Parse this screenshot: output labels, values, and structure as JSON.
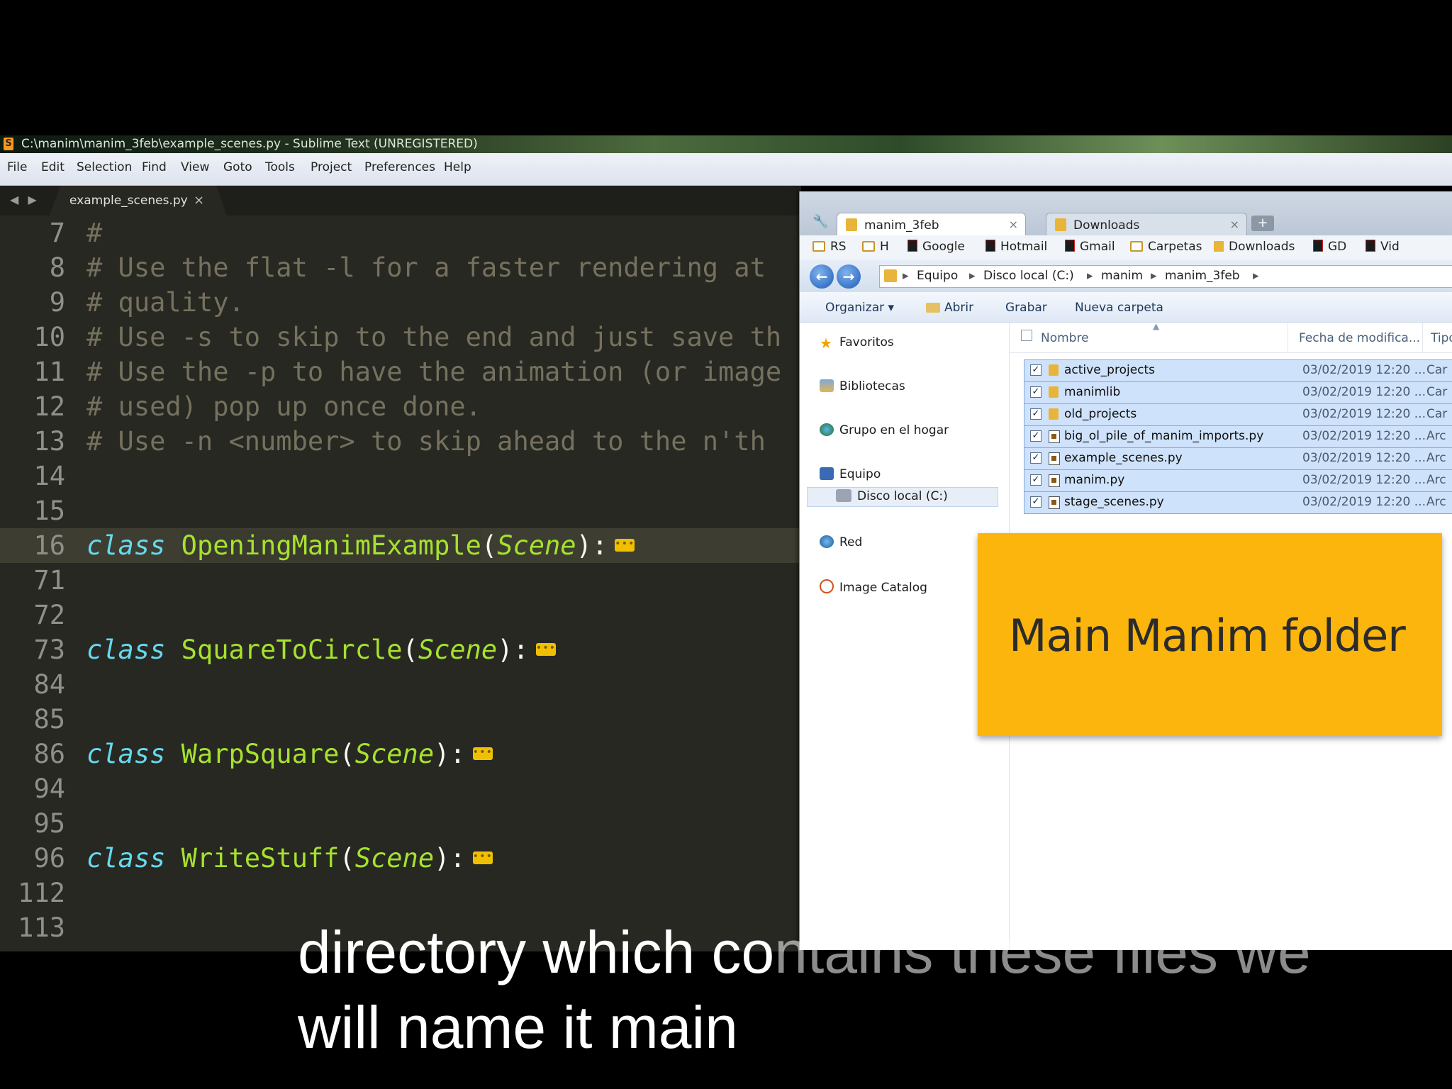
{
  "window": {
    "title": "C:\\manim\\manim_3feb\\example_scenes.py - Sublime Text (UNREGISTERED)",
    "logo": "S"
  },
  "menu": [
    "File",
    "Edit",
    "Selection",
    "Find",
    "View",
    "Goto",
    "Tools",
    "Project",
    "Preferences",
    "Help"
  ],
  "editor": {
    "tab": {
      "label": "example_scenes.py",
      "close": "×"
    },
    "nav_arrows": "◀ ▶",
    "lines": [
      {
        "num": "7",
        "text": "#"
      },
      {
        "num": "8",
        "text": "# Use the flat -l for a faster rendering at"
      },
      {
        "num": "9",
        "text": "# quality."
      },
      {
        "num": "10",
        "text": "# Use -s to skip to the end and just save th"
      },
      {
        "num": "11",
        "text": "# Use the -p to have the animation (or image"
      },
      {
        "num": "12",
        "text": "# used) pop up once done."
      },
      {
        "num": "13",
        "text": "# Use -n <number> to skip ahead to the n'th"
      },
      {
        "num": "14",
        "text": ""
      },
      {
        "num": "15",
        "text": ""
      },
      {
        "num": "16",
        "kw": "class",
        "name": "OpeningManimExample",
        "base": "Scene"
      },
      {
        "num": "71",
        "text": ""
      },
      {
        "num": "72",
        "text": ""
      },
      {
        "num": "73",
        "kw": "class",
        "name": "SquareToCircle",
        "base": "Scene"
      },
      {
        "num": "84",
        "text": ""
      },
      {
        "num": "85",
        "text": ""
      },
      {
        "num": "86",
        "kw": "class",
        "name": "WarpSquare",
        "base": "Scene"
      },
      {
        "num": "94",
        "text": ""
      },
      {
        "num": "95",
        "text": ""
      },
      {
        "num": "96",
        "kw": "class",
        "name": "WriteStuff",
        "base": "Scene"
      },
      {
        "num": "112",
        "text": ""
      },
      {
        "num": "113",
        "text": ""
      }
    ],
    "punct": {
      "open": "(",
      "close": "):",
      "fold": "•••"
    }
  },
  "explorer": {
    "tabs": [
      {
        "label": "manim_3feb",
        "close": "×"
      },
      {
        "label": "Downloads",
        "close": "×"
      }
    ],
    "new_tab": "+",
    "bookmarks": [
      "RS",
      "H",
      "Google",
      "Hotmail",
      "Gmail",
      "Carpetas",
      "Downloads",
      "GD",
      "Vid"
    ],
    "nav": {
      "back": "←",
      "forward": "→"
    },
    "breadcrumbs": [
      "Equipo",
      "Disco local (C:)",
      "manim",
      "manim_3feb"
    ],
    "crumb_sep": "▸",
    "commands": {
      "organize": "Organizar ▾",
      "open": "Abrir",
      "burn": "Grabar",
      "new_folder": "Nueva carpeta"
    },
    "sidebar": [
      "Favoritos",
      "Bibliotecas",
      "Grupo en el hogar",
      "Equipo",
      "Disco local (C:)",
      "Red",
      "Image Catalog"
    ],
    "columns": {
      "name": "Nombre",
      "date": "Fecha de modifica...",
      "type": "Tipo"
    },
    "files": [
      {
        "name": "active_projects",
        "date": "03/02/2019 12:20 ...",
        "type": "Car",
        "kind": "folder"
      },
      {
        "name": "manimlib",
        "date": "03/02/2019 12:20 ...",
        "type": "Car",
        "kind": "folder"
      },
      {
        "name": "old_projects",
        "date": "03/02/2019 12:20 ...",
        "type": "Car",
        "kind": "folder"
      },
      {
        "name": "big_ol_pile_of_manim_imports.py",
        "date": "03/02/2019 12:20 ...",
        "type": "Arc",
        "kind": "py"
      },
      {
        "name": "example_scenes.py",
        "date": "03/02/2019 12:20 ...",
        "type": "Arc",
        "kind": "py"
      },
      {
        "name": "manim.py",
        "date": "03/02/2019 12:20 ...",
        "type": "Arc",
        "kind": "py"
      },
      {
        "name": "stage_scenes.py",
        "date": "03/02/2019 12:20 ...",
        "type": "Arc",
        "kind": "py"
      }
    ],
    "check": "✓"
  },
  "callout": {
    "text": "Main Manim folder",
    "color": "#fbb50c"
  },
  "subtitles": {
    "line1_a": "directory which co",
    "line1_b": "ntains these files we",
    "line2": "will name it main"
  }
}
